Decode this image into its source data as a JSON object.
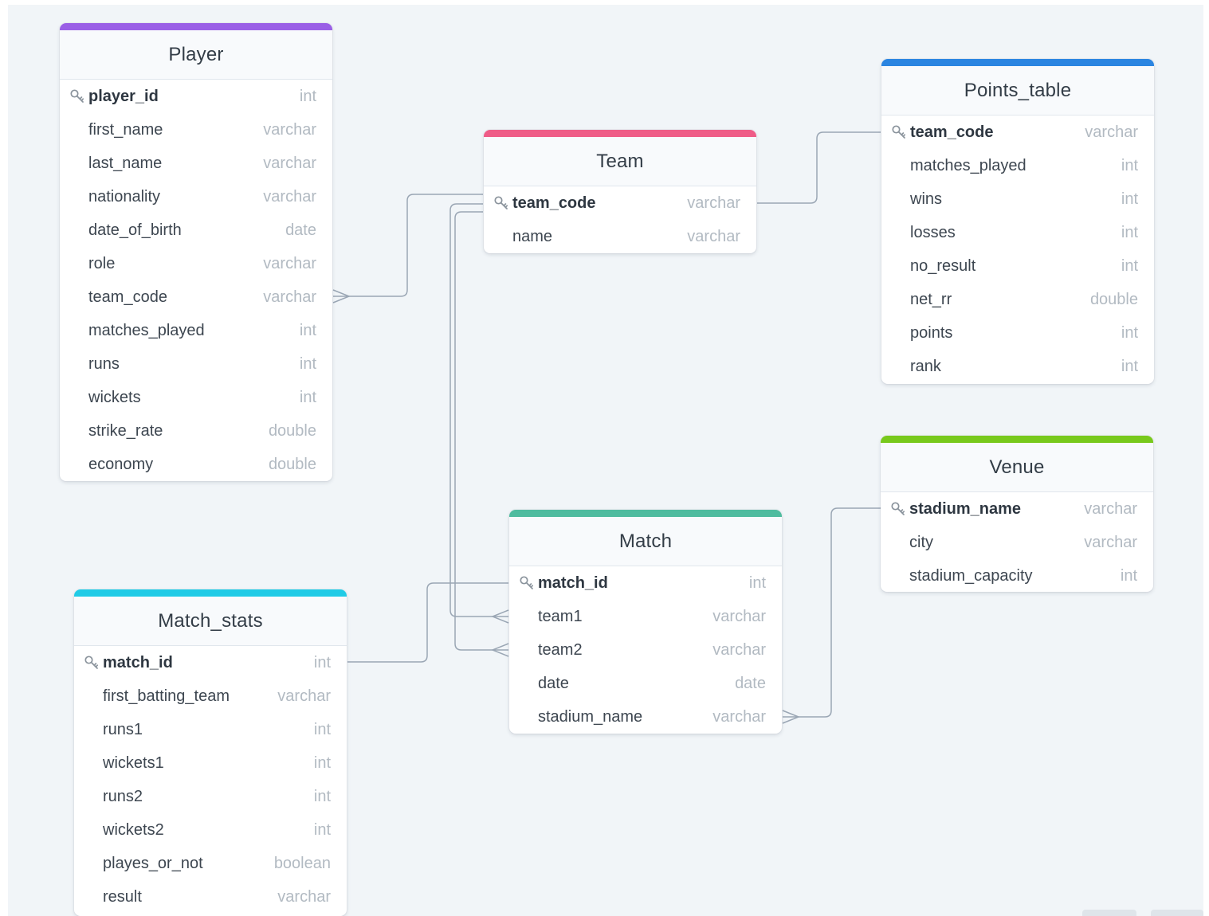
{
  "colors": {
    "player": "#9a5fe6",
    "team": "#ef5c87",
    "points_table": "#2b85e1",
    "venue": "#78c91c",
    "match": "#4fbc9f",
    "match_stats": "#20cbe6",
    "connector": "#9aa6b4"
  },
  "icons": {
    "primary_key": "key-icon"
  },
  "tables": {
    "player": {
      "title": "Player",
      "fields": [
        {
          "name": "player_id",
          "type": "int",
          "pk": true
        },
        {
          "name": "first_name",
          "type": "varchar"
        },
        {
          "name": "last_name",
          "type": "varchar"
        },
        {
          "name": "nationality",
          "type": "varchar"
        },
        {
          "name": "date_of_birth",
          "type": "date"
        },
        {
          "name": "role",
          "type": "varchar"
        },
        {
          "name": "team_code",
          "type": "varchar"
        },
        {
          "name": "matches_played",
          "type": "int"
        },
        {
          "name": "runs",
          "type": "int"
        },
        {
          "name": "wickets",
          "type": "int"
        },
        {
          "name": "strike_rate",
          "type": "double"
        },
        {
          "name": "economy",
          "type": "double"
        }
      ]
    },
    "team": {
      "title": "Team",
      "fields": [
        {
          "name": "team_code",
          "type": "varchar",
          "pk": true
        },
        {
          "name": "name",
          "type": "varchar"
        }
      ]
    },
    "points_table": {
      "title": "Points_table",
      "fields": [
        {
          "name": "team_code",
          "type": "varchar",
          "pk": true
        },
        {
          "name": "matches_played",
          "type": "int"
        },
        {
          "name": "wins",
          "type": "int"
        },
        {
          "name": "losses",
          "type": "int"
        },
        {
          "name": "no_result",
          "type": "int"
        },
        {
          "name": "net_rr",
          "type": "double"
        },
        {
          "name": "points",
          "type": "int"
        },
        {
          "name": "rank",
          "type": "int"
        }
      ]
    },
    "venue": {
      "title": "Venue",
      "fields": [
        {
          "name": "stadium_name",
          "type": "varchar",
          "pk": true
        },
        {
          "name": "city",
          "type": "varchar"
        },
        {
          "name": "stadium_capacity",
          "type": "int"
        }
      ]
    },
    "match": {
      "title": "Match",
      "fields": [
        {
          "name": "match_id",
          "type": "int",
          "pk": true
        },
        {
          "name": "team1",
          "type": "varchar"
        },
        {
          "name": "team2",
          "type": "varchar"
        },
        {
          "name": "date",
          "type": "date"
        },
        {
          "name": "stadium_name",
          "type": "varchar"
        }
      ]
    },
    "match_stats": {
      "title": "Match_stats",
      "fields": [
        {
          "name": "match_id",
          "type": "int",
          "pk": true
        },
        {
          "name": "first_batting_team",
          "type": "varchar"
        },
        {
          "name": "runs1",
          "type": "int"
        },
        {
          "name": "wickets1",
          "type": "int"
        },
        {
          "name": "runs2",
          "type": "int"
        },
        {
          "name": "wickets2",
          "type": "int"
        },
        {
          "name": "playes_or_not",
          "type": "boolean"
        },
        {
          "name": "result",
          "type": "varchar"
        }
      ]
    }
  },
  "relations": [
    {
      "from": "Player.team_code",
      "to": "Team.team_code",
      "cardinality": "many-to-one"
    },
    {
      "from": "Team.team_code",
      "to": "Points_table.team_code",
      "cardinality": "one-to-one"
    },
    {
      "from": "Match.team1",
      "to": "Team.team_code",
      "cardinality": "many-to-one"
    },
    {
      "from": "Match.team2",
      "to": "Team.team_code",
      "cardinality": "many-to-one"
    },
    {
      "from": "Match.stadium_name",
      "to": "Venue.stadium_name",
      "cardinality": "many-to-one"
    },
    {
      "from": "Match_stats.match_id",
      "to": "Match.match_id",
      "cardinality": "one-to-one"
    }
  ]
}
